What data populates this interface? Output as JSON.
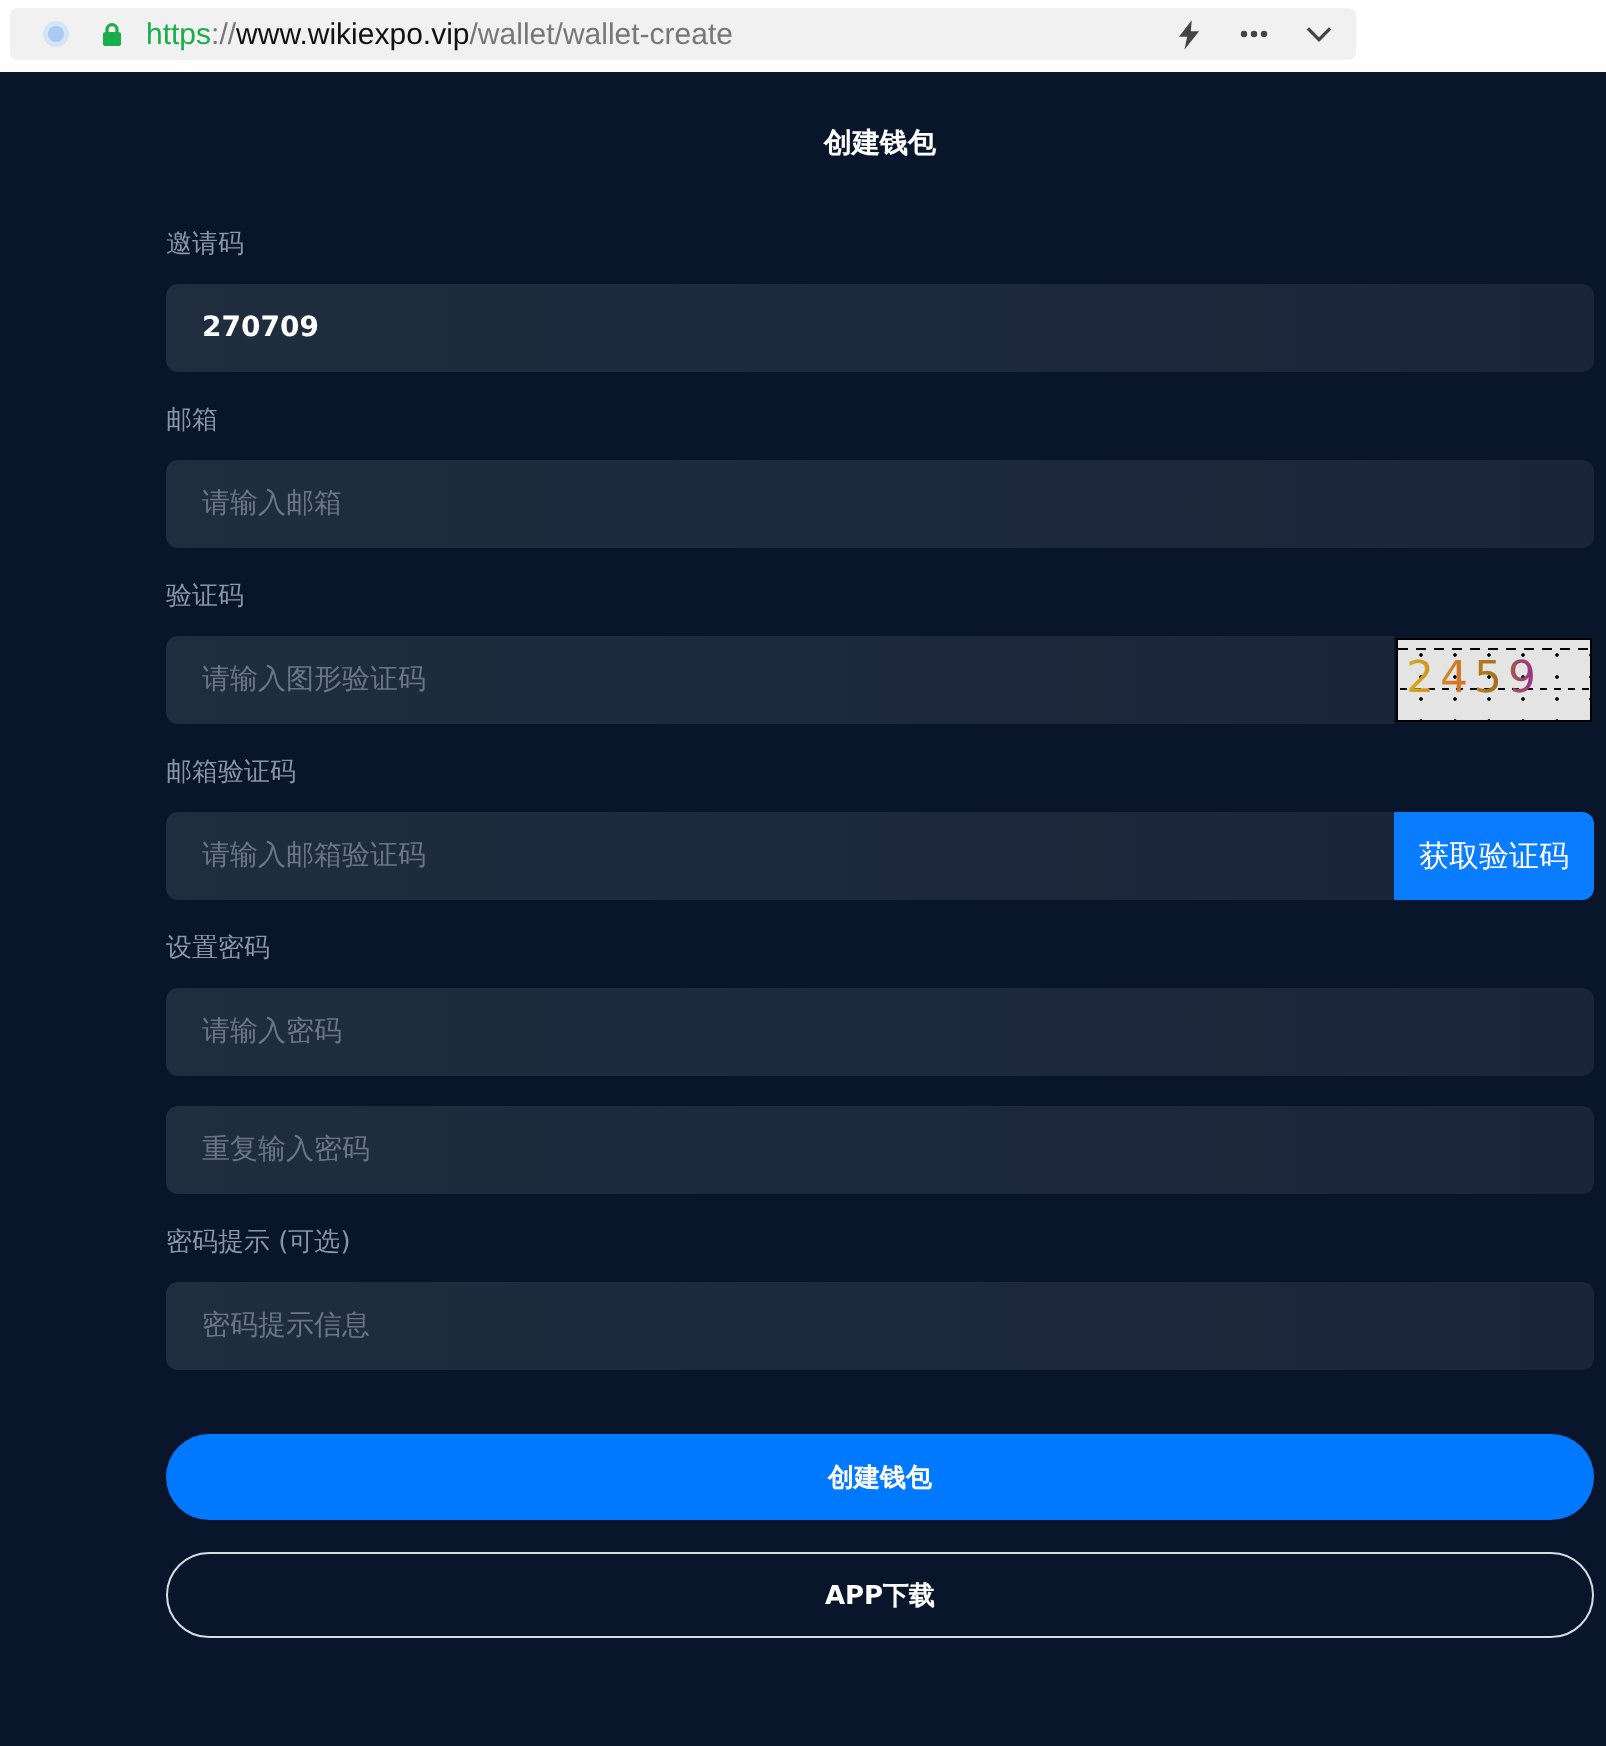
{
  "browser": {
    "url": "https://www.wikiexpo.vip/wallet/wallet-create"
  },
  "title": "创建钱包",
  "fields": [
    {
      "kind": "plain",
      "label": "邀请码",
      "value": "270709"
    },
    {
      "kind": "plain",
      "label": "邮箱",
      "placeholder": "请输入邮箱"
    },
    {
      "kind": "captcha",
      "label": "验证码",
      "placeholder": "请输入图形验证码",
      "captcha": "2459"
    },
    {
      "kind": "send_code",
      "label": "邮箱验证码",
      "placeholder": "请输入邮箱验证码",
      "button": "获取验证码"
    },
    {
      "kind": "plain",
      "label": "设置密码",
      "placeholder": "请输入密码"
    },
    {
      "kind": "plain",
      "placeholder": "重复输入密码"
    },
    {
      "kind": "plain",
      "label": "密码提示 (可选)",
      "placeholder": "密码提示信息"
    }
  ],
  "buttons": [
    {
      "kind": "primary",
      "label": "创建钱包"
    },
    {
      "kind": "outline",
      "label": "APP下载"
    }
  ]
}
